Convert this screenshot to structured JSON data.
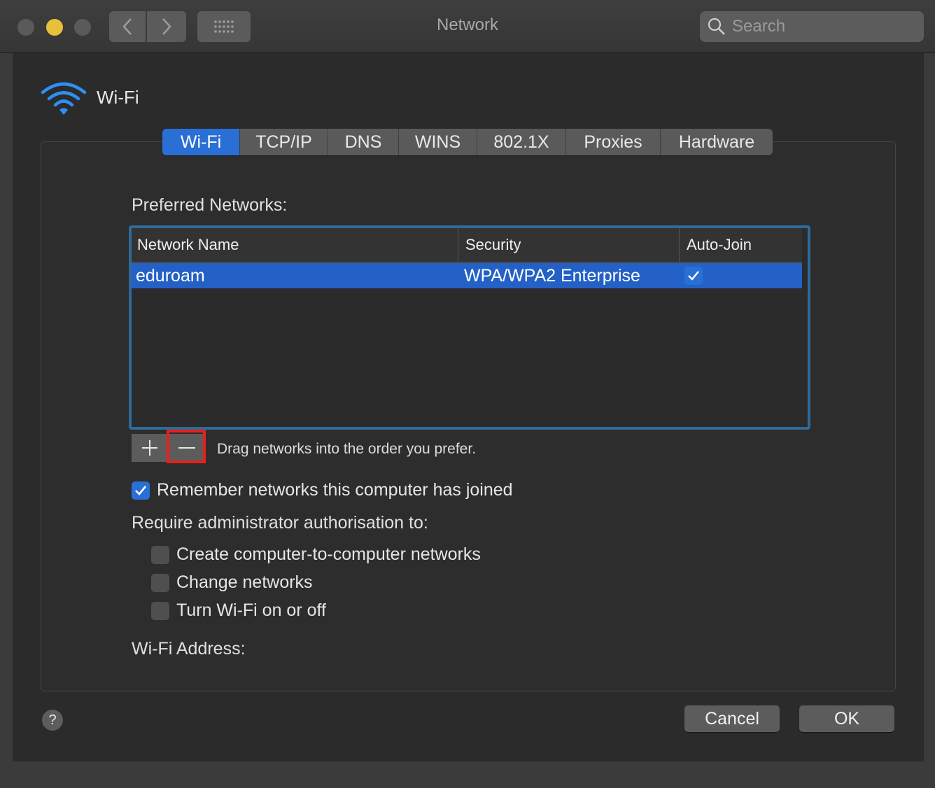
{
  "window": {
    "title": "Network",
    "search_placeholder": "Search"
  },
  "header": {
    "service_label": "Wi-Fi"
  },
  "tabs": [
    {
      "label": "Wi-Fi",
      "active": true
    },
    {
      "label": "TCP/IP"
    },
    {
      "label": "DNS"
    },
    {
      "label": "WINS"
    },
    {
      "label": "802.1X"
    },
    {
      "label": "Proxies"
    },
    {
      "label": "Hardware"
    }
  ],
  "preferred": {
    "label": "Preferred Networks:",
    "columns": [
      "Network Name",
      "Security",
      "Auto-Join"
    ],
    "rows": [
      {
        "name": "eduroam",
        "security": "WPA/WPA2 Enterprise",
        "auto_join": true
      }
    ],
    "drag_hint": "Drag networks into the order you prefer."
  },
  "options": {
    "remember": {
      "label": "Remember networks this computer has joined",
      "checked": true
    },
    "require_label": "Require administrator authorisation to:",
    "require": [
      {
        "label": "Create computer-to-computer networks",
        "checked": false
      },
      {
        "label": "Change networks",
        "checked": false
      },
      {
        "label": "Turn Wi-Fi on or off",
        "checked": false
      }
    ],
    "address_label": "Wi-Fi Address:"
  },
  "footer": {
    "help": "?",
    "cancel": "Cancel",
    "ok": "OK"
  },
  "icons": {
    "wifi": "wifi-icon",
    "search": "search-icon",
    "back": "chevron-left-icon",
    "forward": "chevron-right-icon",
    "grid": "grid-icon",
    "add": "plus-icon",
    "remove": "minus-icon",
    "check": "checkmark-icon"
  },
  "colors": {
    "accent": "#2a6fd6",
    "selection": "#2361c6",
    "highlight": "#e8201a",
    "minimize": "#e8c13b"
  }
}
